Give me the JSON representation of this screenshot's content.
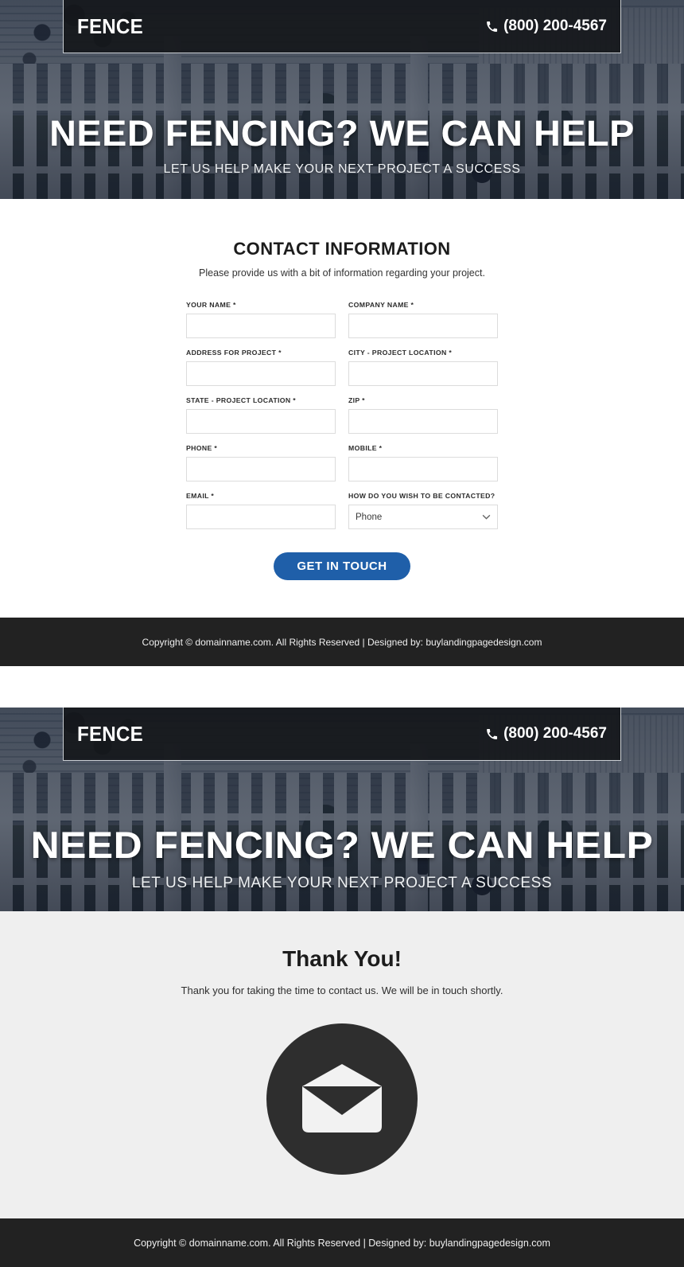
{
  "header": {
    "logo": "FENCE",
    "phone": "(800) 200-4567",
    "phone_icon": "phone-icon"
  },
  "hero": {
    "title": "NEED FENCING? WE CAN HELP",
    "subtitle": "LET US HELP MAKE YOUR NEXT PROJECT A SUCCESS"
  },
  "form": {
    "title": "CONTACT INFORMATION",
    "description": "Please provide us with a bit of information regarding your project.",
    "fields": [
      {
        "label": "YOUR NAME *",
        "name": "your-name",
        "value": "",
        "type": "text"
      },
      {
        "label": "COMPANY NAME *",
        "name": "company-name",
        "value": "",
        "type": "text"
      },
      {
        "label": "ADDRESS FOR PROJECT *",
        "name": "address-for-project",
        "value": "",
        "type": "text"
      },
      {
        "label": "CITY - PROJECT LOCATION *",
        "name": "city-project-location",
        "value": "",
        "type": "text"
      },
      {
        "label": "STATE - PROJECT LOCATION *",
        "name": "state-project-location",
        "value": "",
        "type": "text"
      },
      {
        "label": "ZIP *",
        "name": "zip",
        "value": "",
        "type": "text"
      },
      {
        "label": "PHONE *",
        "name": "phone",
        "value": "",
        "type": "text"
      },
      {
        "label": "MOBILE *",
        "name": "mobile",
        "value": "",
        "type": "text"
      },
      {
        "label": "EMAIL *",
        "name": "email",
        "value": "",
        "type": "text"
      }
    ],
    "contact_preference": {
      "label": "HOW DO YOU WISH TO BE CONTACTED?",
      "selected": "Phone",
      "chevron_icon": "chevron-down-icon"
    },
    "submit_label": "GET IN TOUCH",
    "submit_color": "#1f5fa9"
  },
  "footer": {
    "text": "Copyright © domainname.com. All Rights Reserved | Designed by: buylandingpagedesign.com"
  },
  "thanks": {
    "title": "Thank You!",
    "description": "Thank you for taking the time to contact us. We will be in touch shortly.",
    "icon": "envelope-icon",
    "icon_bg": "#2e2e2e"
  }
}
